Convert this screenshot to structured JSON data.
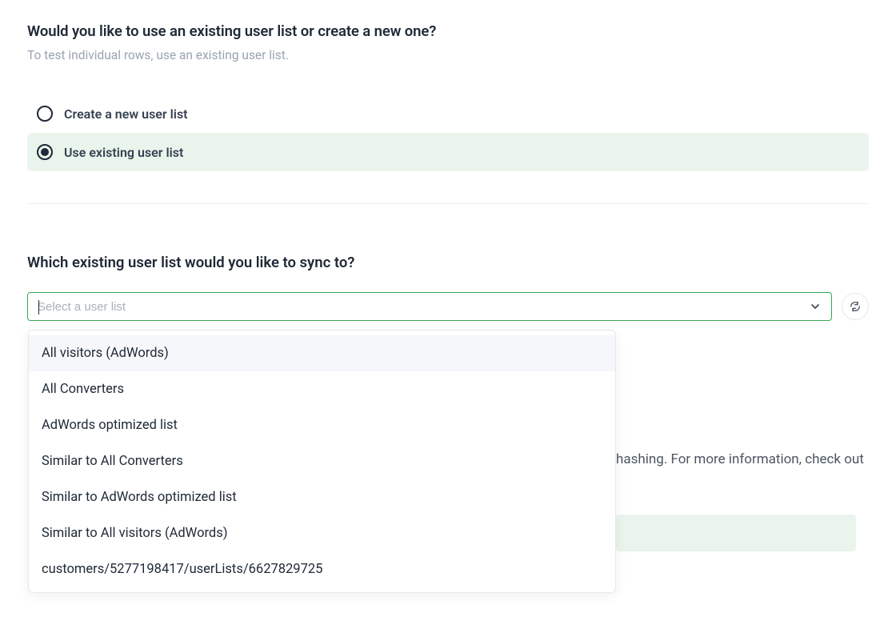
{
  "section1": {
    "title": "Would you like to use an existing user list or create a new one?",
    "subtitle": "To test individual rows, use an existing user list.",
    "options": [
      {
        "label": "Create a new user list",
        "selected": false
      },
      {
        "label": "Use existing user list",
        "selected": true
      }
    ]
  },
  "section2": {
    "title": "Which existing user list would you like to sync to?",
    "placeholder": "Select a user list",
    "options": [
      "All visitors (AdWords)",
      "All Converters",
      "AdWords optimized list",
      "Similar to All Converters",
      "Similar to AdWords optimized list",
      "Similar to All visitors (AdWords)",
      "customers/5277198417/userLists/6627829725"
    ]
  },
  "background": {
    "hash_text_fragment": "hashing. For more information, check out"
  }
}
